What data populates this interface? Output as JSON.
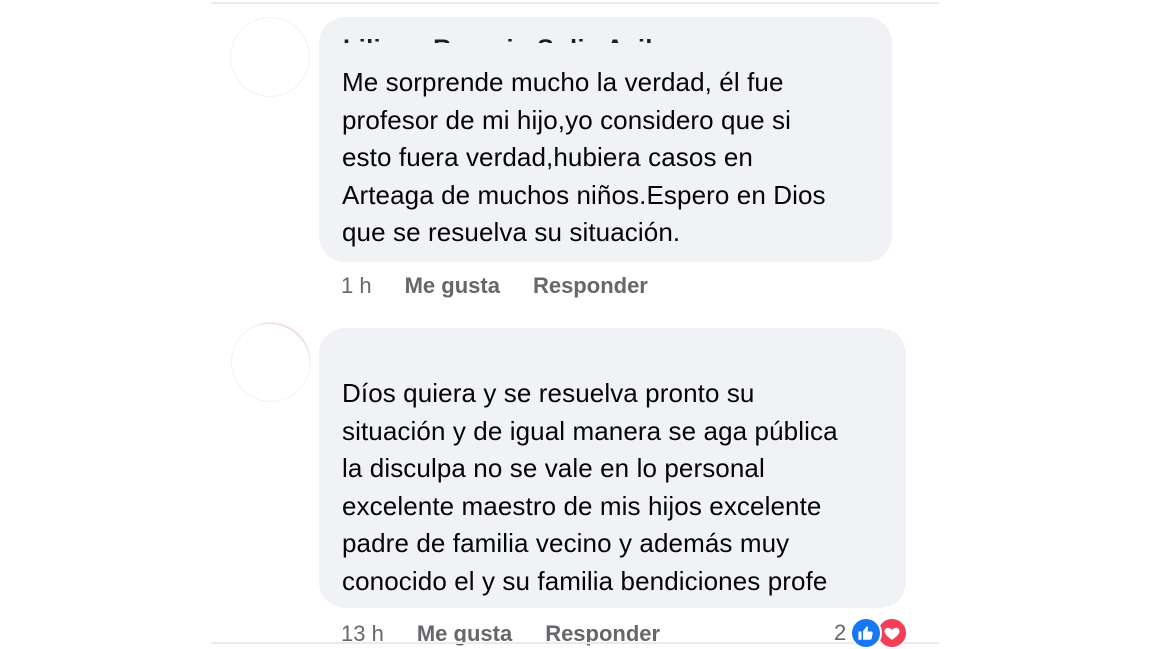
{
  "comments": [
    {
      "author": "Liliana Rosario Solis Avila",
      "text": "Me sorprende mucho la verdad, él fue\nprofesor de mi hijo,yo considero que si\nesto fuera verdad,hubiera casos en\nArteaga de muchos niños.Espero en Dios\nque se resuelva su situación.",
      "time": "1 h",
      "like_label": "Me gusta",
      "reply_label": "Responder"
    },
    {
      "text": "Díos quiera y se resuelva pronto su\nsituación y de igual manera se aga pública\nla disculpa no se vale en lo personal\nexcelente maestro de mis hijos excelente\npadre de familia vecino y además muy\nconocido el y su familia bendiciones profe",
      "time": "13 h",
      "like_label": "Me gusta",
      "reply_label": "Responder",
      "reaction_count": "2",
      "reactions": [
        "like-icon",
        "love-icon"
      ]
    }
  ],
  "colors": {
    "bubble": "#f0f2f5",
    "meta_text": "#65676b",
    "like": "#1877f2",
    "love": "#f33e58"
  }
}
